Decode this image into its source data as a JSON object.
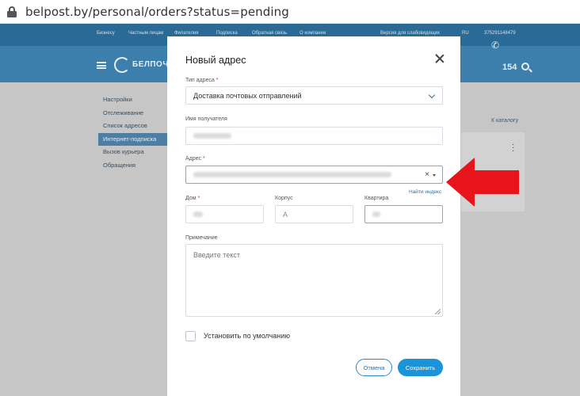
{
  "browser": {
    "url": "belpost.by/personal/orders?status=pending"
  },
  "site": {
    "topnav": [
      "Бизнесу",
      "Частным лицам",
      "Филателия",
      "Подписка",
      "Обратная связь",
      "О компании",
      "Версия для слабовидящих",
      "RU",
      "375291148479"
    ],
    "logo_text": "БЕЛПОЧТА",
    "phone": "154",
    "sidebar": [
      "Настройки",
      "Отслеживание",
      "Список адресов",
      "Интернет-подписка",
      "Вызов курьера",
      "Обращения"
    ],
    "sidebar_active": 3,
    "catalog_link": "К каталогу"
  },
  "modal": {
    "title": "Новый адрес",
    "address_type": {
      "label": "Тип адреса",
      "required": "*",
      "value": "Доставка почтовых отправлений"
    },
    "recipient": {
      "label": "Имя получателя"
    },
    "address": {
      "label": "Адрес",
      "required": "*"
    },
    "find_index": "Найти индекс",
    "house": {
      "label": "Дом",
      "required": "*"
    },
    "building": {
      "label": "Корпус",
      "value": "А"
    },
    "apartment": {
      "label": "Квартира"
    },
    "note": {
      "label": "Примечание",
      "placeholder": "Введите текст"
    },
    "default_checkbox": {
      "label": "Установить по умолчанию",
      "checked": false
    },
    "cancel_button": "Отмена",
    "save_button": "Сохранить"
  },
  "colors": {
    "arrow": "#e8141b",
    "primary": "#1a93d8",
    "header": "#3c7fad"
  }
}
